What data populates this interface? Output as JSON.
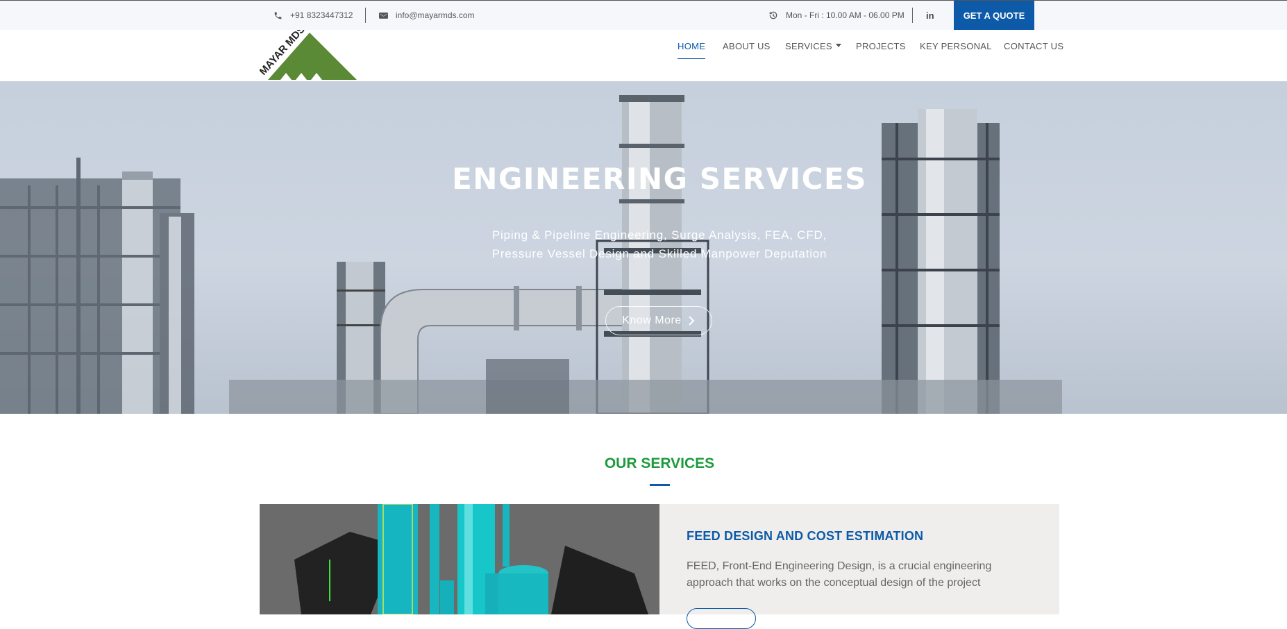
{
  "topbar": {
    "phone": "+91 8323447312",
    "email": "info@mayarmds.com",
    "hours": "Mon - Fri : 10.00 AM - 06.00 PM",
    "social": "in",
    "quote_label": "GET A QUOTE"
  },
  "logo": {
    "text": "MAYAR MDS"
  },
  "nav": {
    "home": "HOME",
    "about": "ABOUT US",
    "services": "SERVICES",
    "projects": "PROJECTS",
    "key_personal": "KEY PERSONAL",
    "contact": "CONTACT US"
  },
  "hero": {
    "title": "ENGINEERING SERVICES",
    "subtitle_line1": "Piping & Pipeline Engineering, Surge Analysis, FEA, CFD,",
    "subtitle_line2": "Pressure Vessel Design and Skilled Manpower Deputation",
    "button": "Know More"
  },
  "services": {
    "heading": "OUR SERVICES",
    "card": {
      "title": "FEED DESIGN AND COST ESTIMATION",
      "text": "FEED, Front-End Engineering Design, is a crucial engineering approach that works on the conceptual design of the project"
    }
  },
  "colors": {
    "brand_blue": "#0c5aa8",
    "brand_green": "#1d9b3c",
    "logo_green": "#5b8a36"
  }
}
